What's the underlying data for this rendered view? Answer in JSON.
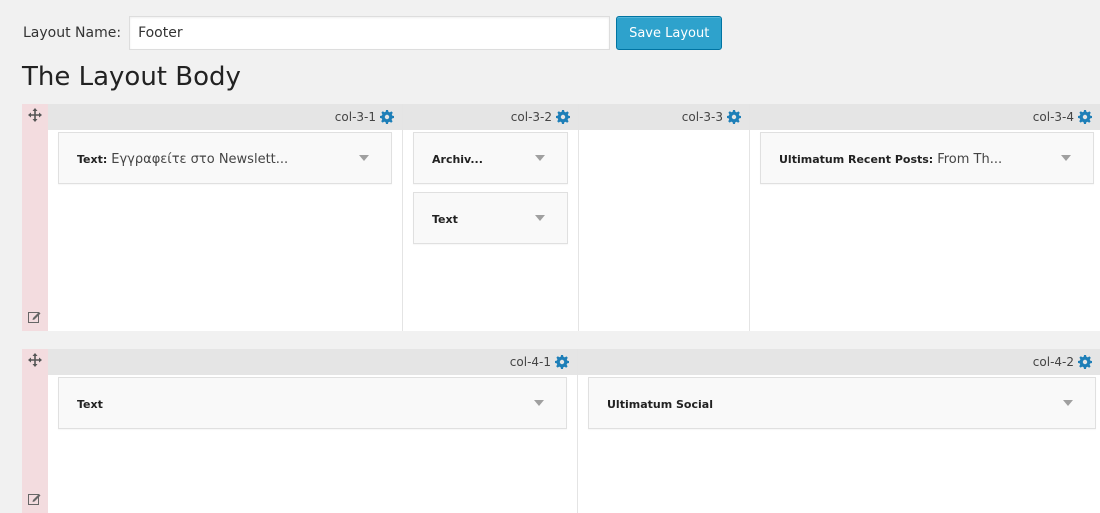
{
  "layout_name": {
    "label": "Layout Name:",
    "value": "Footer"
  },
  "save_button": "Save Layout",
  "page_title": "The Layout Body",
  "rows": [
    {
      "columns": [
        {
          "name": "col-3-1",
          "widgets": [
            {
              "type": "Text:",
              "title": "Εγγραφείτε στο Newslett..."
            }
          ]
        },
        {
          "name": "col-3-2",
          "widgets": [
            {
              "type": "Archiv...",
              "title": ""
            },
            {
              "type": "Text",
              "title": ""
            }
          ]
        },
        {
          "name": "col-3-3",
          "widgets": []
        },
        {
          "name": "col-3-4",
          "widgets": [
            {
              "type": "Ultimatum Recent Posts:",
              "title": "From Th..."
            }
          ]
        }
      ]
    },
    {
      "columns": [
        {
          "name": "col-4-1",
          "widgets": [
            {
              "type": "Text",
              "title": ""
            }
          ]
        },
        {
          "name": "col-4-2",
          "widgets": [
            {
              "type": "Ultimatum Social",
              "title": ""
            }
          ]
        }
      ]
    }
  ],
  "icons": {
    "move": "move-arrows-icon",
    "edit": "edit-pencil-icon",
    "settings": "gear-icon",
    "dropdown": "caret-down-icon"
  },
  "colors": {
    "accent": "#2ea2cc",
    "gear": "#1e7fb8",
    "row_handle": "#f3dcdf",
    "column_header": "#e5e5e5"
  }
}
